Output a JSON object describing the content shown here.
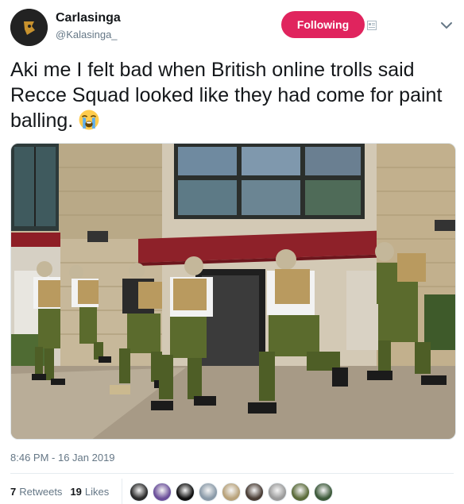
{
  "user": {
    "name": "Carlasinga",
    "handle": "@Kalasinga_",
    "follow_label": "Following"
  },
  "tweet": {
    "text": "Aki me I felt bad when British online trolls said Recce Squad looked like they had come for paint balling.",
    "emoji": "loudly-crying-face"
  },
  "meta": {
    "timestamp": "8:46 PM - 16 Jan 2019",
    "retweets_count": "7",
    "retweets_label": "Retweets",
    "likes_count": "19",
    "likes_label": "Likes"
  },
  "colors": {
    "follow_button": "#e0245e",
    "secondary_text": "#657786",
    "primary_text": "#14171a"
  },
  "likers": [
    {
      "icon": "liker-avatar-1",
      "color": "#2b2b2b"
    },
    {
      "icon": "liker-avatar-2",
      "color": "#6b4f9a"
    },
    {
      "icon": "liker-avatar-3",
      "color": "#111111"
    },
    {
      "icon": "liker-avatar-4",
      "color": "#8a9aa8"
    },
    {
      "icon": "liker-avatar-5",
      "color": "#b8a27a"
    },
    {
      "icon": "liker-avatar-6",
      "color": "#4a3d35"
    },
    {
      "icon": "liker-avatar-7",
      "color": "#9b9b9b"
    },
    {
      "icon": "liker-avatar-8",
      "color": "#5b6b3a"
    },
    {
      "icon": "liker-avatar-9",
      "color": "#3d5a3a"
    }
  ]
}
